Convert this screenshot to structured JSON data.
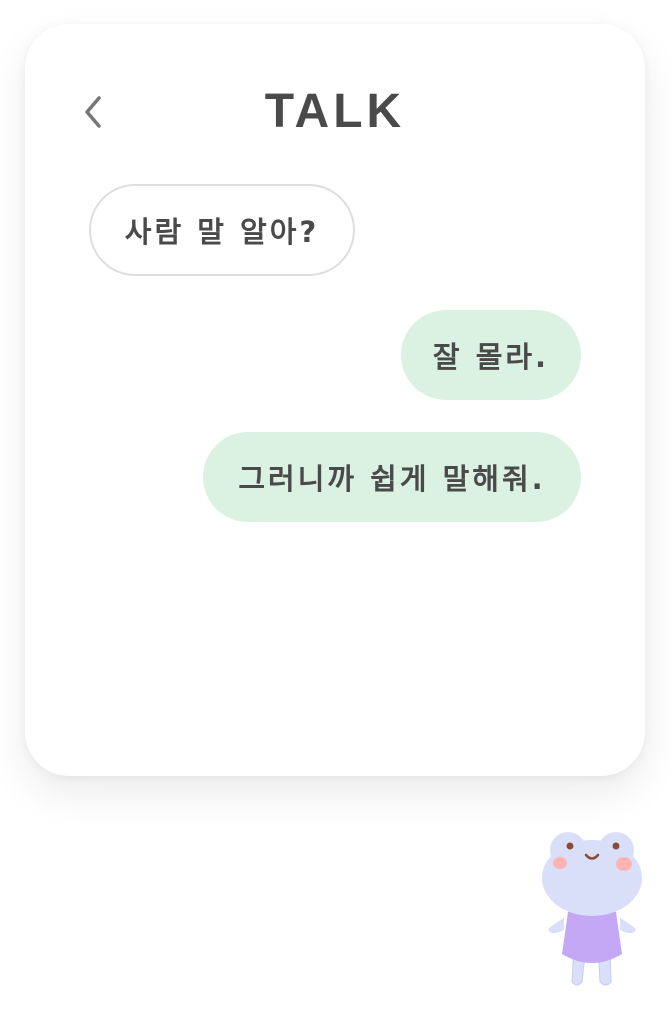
{
  "header": {
    "title": "TALK",
    "back_icon": "chevron-left-icon"
  },
  "messages": [
    {
      "side": "incoming",
      "text": "사람 말 알아?"
    },
    {
      "side": "outgoing",
      "text": "잘 몰라."
    },
    {
      "side": "outgoing",
      "text": "그러니까 쉽게 말해줘."
    }
  ],
  "colors": {
    "card_background": "#ffffff",
    "title_text": "#4a4a4a",
    "incoming_bubble_border": "#dedede",
    "outgoing_bubble_background": "#dbf1e2",
    "mascot_body": "#d9def9",
    "mascot_dress": "#c4a8f5",
    "mascot_cheeks": "#ffb3b3"
  },
  "mascot": {
    "icon": "frog-mascot-icon"
  }
}
